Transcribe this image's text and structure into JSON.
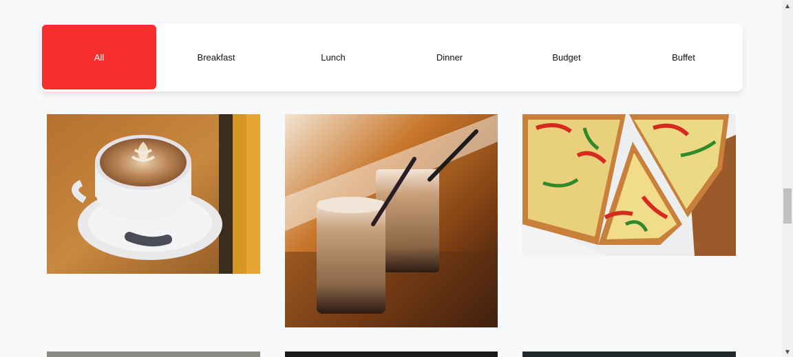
{
  "filters": [
    {
      "label": "All",
      "active": true
    },
    {
      "label": "Breakfast",
      "active": false
    },
    {
      "label": "Lunch",
      "active": false
    },
    {
      "label": "Dinner",
      "active": false
    },
    {
      "label": "Budget",
      "active": false
    },
    {
      "label": "Buffet",
      "active": false
    }
  ],
  "gallery": [
    {
      "subject": "latte-art-coffee-cup"
    },
    {
      "subject": "iced-coffee-glasses"
    },
    {
      "subject": "pizza-slices"
    },
    {
      "subject": "partially-visible-image"
    },
    {
      "subject": "partially-visible-image"
    },
    {
      "subject": "partially-visible-image"
    }
  ],
  "colors": {
    "accent": "#f72c2c",
    "background": "#f8f9fb",
    "bar": "#ffffff"
  },
  "scrollbar": {
    "up_icon": "▲",
    "down_icon": "▼"
  }
}
